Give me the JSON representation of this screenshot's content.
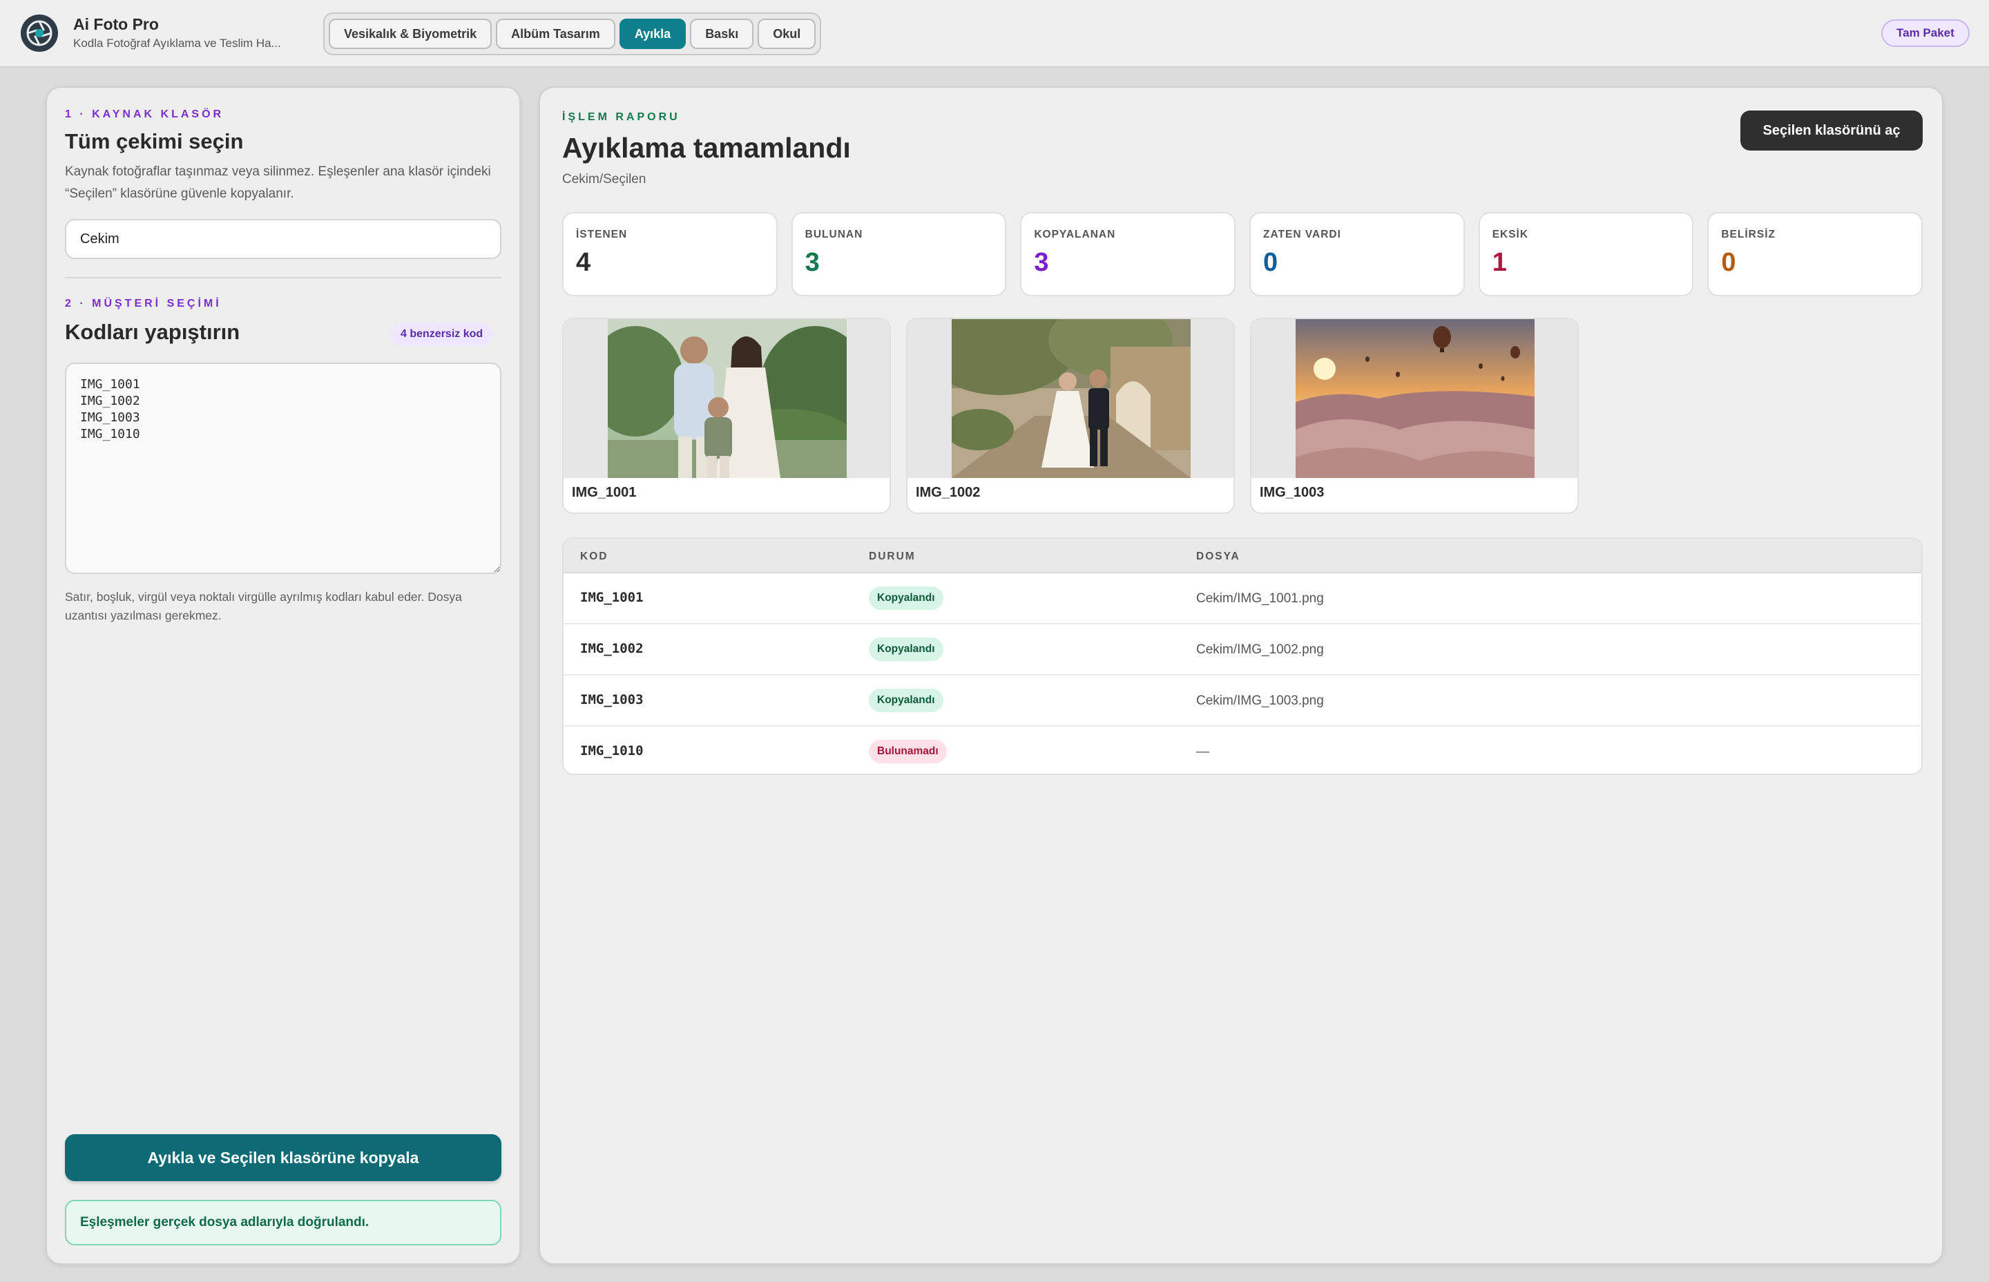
{
  "app": {
    "title": "Ai Foto Pro",
    "subtitle": "Kodla Fotoğraf Ayıklama ve Teslim Ha...",
    "plan": "Tam Paket"
  },
  "tabs": [
    {
      "label": "Vesikalık & Biyometrik",
      "active": false
    },
    {
      "label": "Albüm Tasarım",
      "active": false
    },
    {
      "label": "Ayıkla",
      "active": true
    },
    {
      "label": "Baskı",
      "active": false
    },
    {
      "label": "Okul",
      "active": false
    }
  ],
  "source": {
    "step": "1 · KAYNAK KLASÖR",
    "title": "Tüm çekimi seçin",
    "help": "Kaynak fotoğraflar taşınmaz veya silinmez. Eşleşenler ana klasör içindeki “Seçilen” klasörüne güvenle kopyalanır.",
    "folder_value": "Cekim"
  },
  "selection": {
    "step": "2 · MÜŞTERİ SEÇİMİ",
    "title": "Kodları yapıştırın",
    "unique_badge": "4 benzersiz kod",
    "codes_text": "IMG_1001\nIMG_1002\nIMG_1003\nIMG_1010",
    "help": "Satır, boşluk, virgül veya noktalı virgülle ayrılmış kodları kabul eder. Dosya uzantısı yazılması gerekmez."
  },
  "actions": {
    "run_label": "Ayıkla ve Seçilen klasörüne kopyala",
    "status_note": "Eşleşmeler gerçek dosya adlarıyla doğrulandı."
  },
  "report": {
    "label": "İŞLEM RAPORU",
    "title": "Ayıklama tamamlandı",
    "path": "Cekim/Seçilen",
    "open_button": "Seçilen klasörünü aç",
    "stats": [
      {
        "label": "İSTENEN",
        "value": "4",
        "color": "#2b2b2b"
      },
      {
        "label": "BULUNAN",
        "value": "3",
        "color": "#137a4e"
      },
      {
        "label": "KOPYALANAN",
        "value": "3",
        "color": "#7a1fd0"
      },
      {
        "label": "ZATEN VARDI",
        "value": "0",
        "color": "#0f5f9a"
      },
      {
        "label": "EKSİK",
        "value": "1",
        "color": "#b0163f"
      },
      {
        "label": "BELİRSİZ",
        "value": "0",
        "color": "#b85a12"
      }
    ],
    "photos": [
      {
        "caption": "IMG_1001",
        "scene": "family"
      },
      {
        "caption": "IMG_1002",
        "scene": "wedding"
      },
      {
        "caption": "IMG_1003",
        "scene": "balloons"
      }
    ],
    "table": {
      "headers": [
        "KOD",
        "DURUM",
        "DOSYA"
      ],
      "rows": [
        {
          "code": "IMG_1001",
          "status": "Kopyalandı",
          "kind": "ok",
          "file": "Cekim/IMG_1001.png"
        },
        {
          "code": "IMG_1002",
          "status": "Kopyalandı",
          "kind": "ok",
          "file": "Cekim/IMG_1002.png"
        },
        {
          "code": "IMG_1003",
          "status": "Kopyalandı",
          "kind": "ok",
          "file": "Cekim/IMG_1003.png"
        },
        {
          "code": "IMG_1010",
          "status": "Bulunamadı",
          "kind": "missing",
          "file": "—"
        }
      ]
    }
  }
}
